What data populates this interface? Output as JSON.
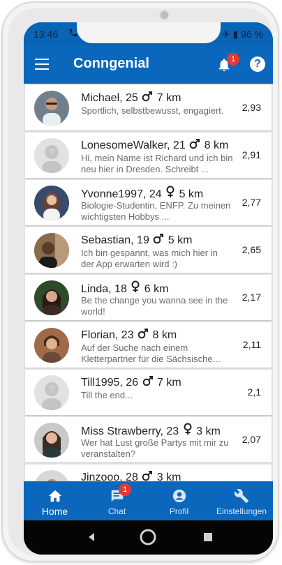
{
  "status": {
    "time": "13:46",
    "battery": "96 %"
  },
  "app": {
    "title": "Conngenial",
    "notification_count": "1"
  },
  "profiles": [
    {
      "name": "Michael, 25",
      "gender": "male",
      "distance": "7 km",
      "description": "Sportlich, selbstbewusst, engagiert.",
      "score": "2,93"
    },
    {
      "name": "LonesomeWalker, 21",
      "gender": "male",
      "distance": "8 km",
      "description": "Hi, mein Name ist Richard und ich bin neu hier in Dresden. Schreibt ...",
      "score": "2,91"
    },
    {
      "name": "Yvonne1997, 24",
      "gender": "female",
      "distance": "5 km",
      "description": "Biologie-Studentin, ENFP. Zu meinen wichtigsten Hobbys ...",
      "score": "2,77"
    },
    {
      "name": "Sebastian, 19",
      "gender": "male",
      "distance": "5 km",
      "description": "Ich bin gespannt, was mich hier in der App erwarten wird :)",
      "score": "2,65"
    },
    {
      "name": "Linda, 18",
      "gender": "female",
      "distance": "6 km",
      "description": "Be the change you wanna see in the world!",
      "score": "2,17"
    },
    {
      "name": "Florian, 23",
      "gender": "male",
      "distance": "8 km",
      "description": "Auf der Suche nach einem Kletterpartner für die Sächsische...",
      "score": "2,11"
    },
    {
      "name": "Till1995, 26",
      "gender": "male",
      "distance": "7 km",
      "description": "Till the end...",
      "score": "2,1"
    },
    {
      "name": "Miss Strawberry, 23",
      "gender": "female",
      "distance": "3 km",
      "description": "Wer hat Lust große Partys mit mir zu veranstalten?",
      "score": "2,07"
    },
    {
      "name": "Jinzooo, 28",
      "gender": "male",
      "distance": "3 km",
      "description": "",
      "score": ""
    }
  ],
  "bottom_nav": [
    {
      "label": "Home",
      "icon": "home-icon"
    },
    {
      "label": "Chat",
      "icon": "chat-icon",
      "badge": "1"
    },
    {
      "label": "Profil",
      "icon": "profile-icon"
    },
    {
      "label": "Einstellungen",
      "icon": "wrench-icon"
    }
  ],
  "colors": {
    "primary": "#0b67bb",
    "badge": "#e53935"
  }
}
